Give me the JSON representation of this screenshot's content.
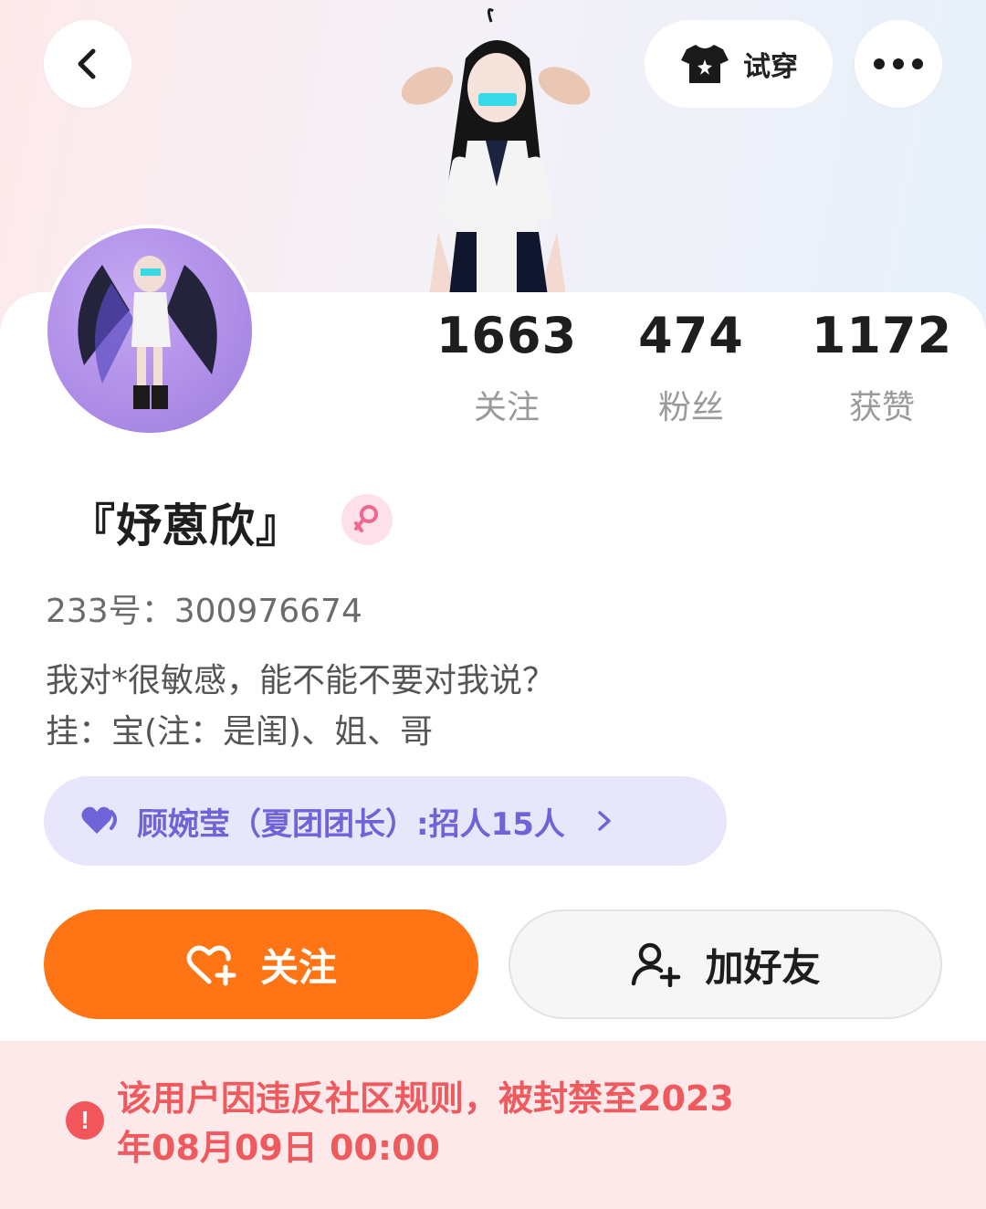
{
  "header": {
    "back_icon": "chevron-left-icon",
    "tryon_label": "试穿",
    "tryon_icon": "tshirt-icon",
    "more_icon": "more-dots-icon"
  },
  "profile": {
    "nickname": "『妤蒽欣』",
    "gender_icon": "female-icon",
    "gender_color": "#f0688f",
    "id_line": "233号：300976674",
    "bio_line1": "我对*很敏感，能不能不要对我说？",
    "bio_line2": "挂：宝(注：是闺)、姐、哥"
  },
  "stats": [
    {
      "value": "1663",
      "label": "关注"
    },
    {
      "value": "474",
      "label": "粉丝"
    },
    {
      "value": "1172",
      "label": "获赞"
    }
  ],
  "group": {
    "icon": "heart-icon",
    "label": "顾婉莹（夏团团长）:招人15人",
    "chevron": "chevron-right-icon"
  },
  "actions": {
    "follow_label": "关注",
    "follow_icon": "heart-plus-icon",
    "follow_color": "#ff7414",
    "add_friend_label": "加好友",
    "add_friend_icon": "user-plus-icon"
  },
  "notice": {
    "icon": "alert-icon",
    "text_line1": "该用户因违反社区规则，被封禁至2023",
    "text_line2": "年08月09日 00:00",
    "color": "#ef5a5e"
  }
}
